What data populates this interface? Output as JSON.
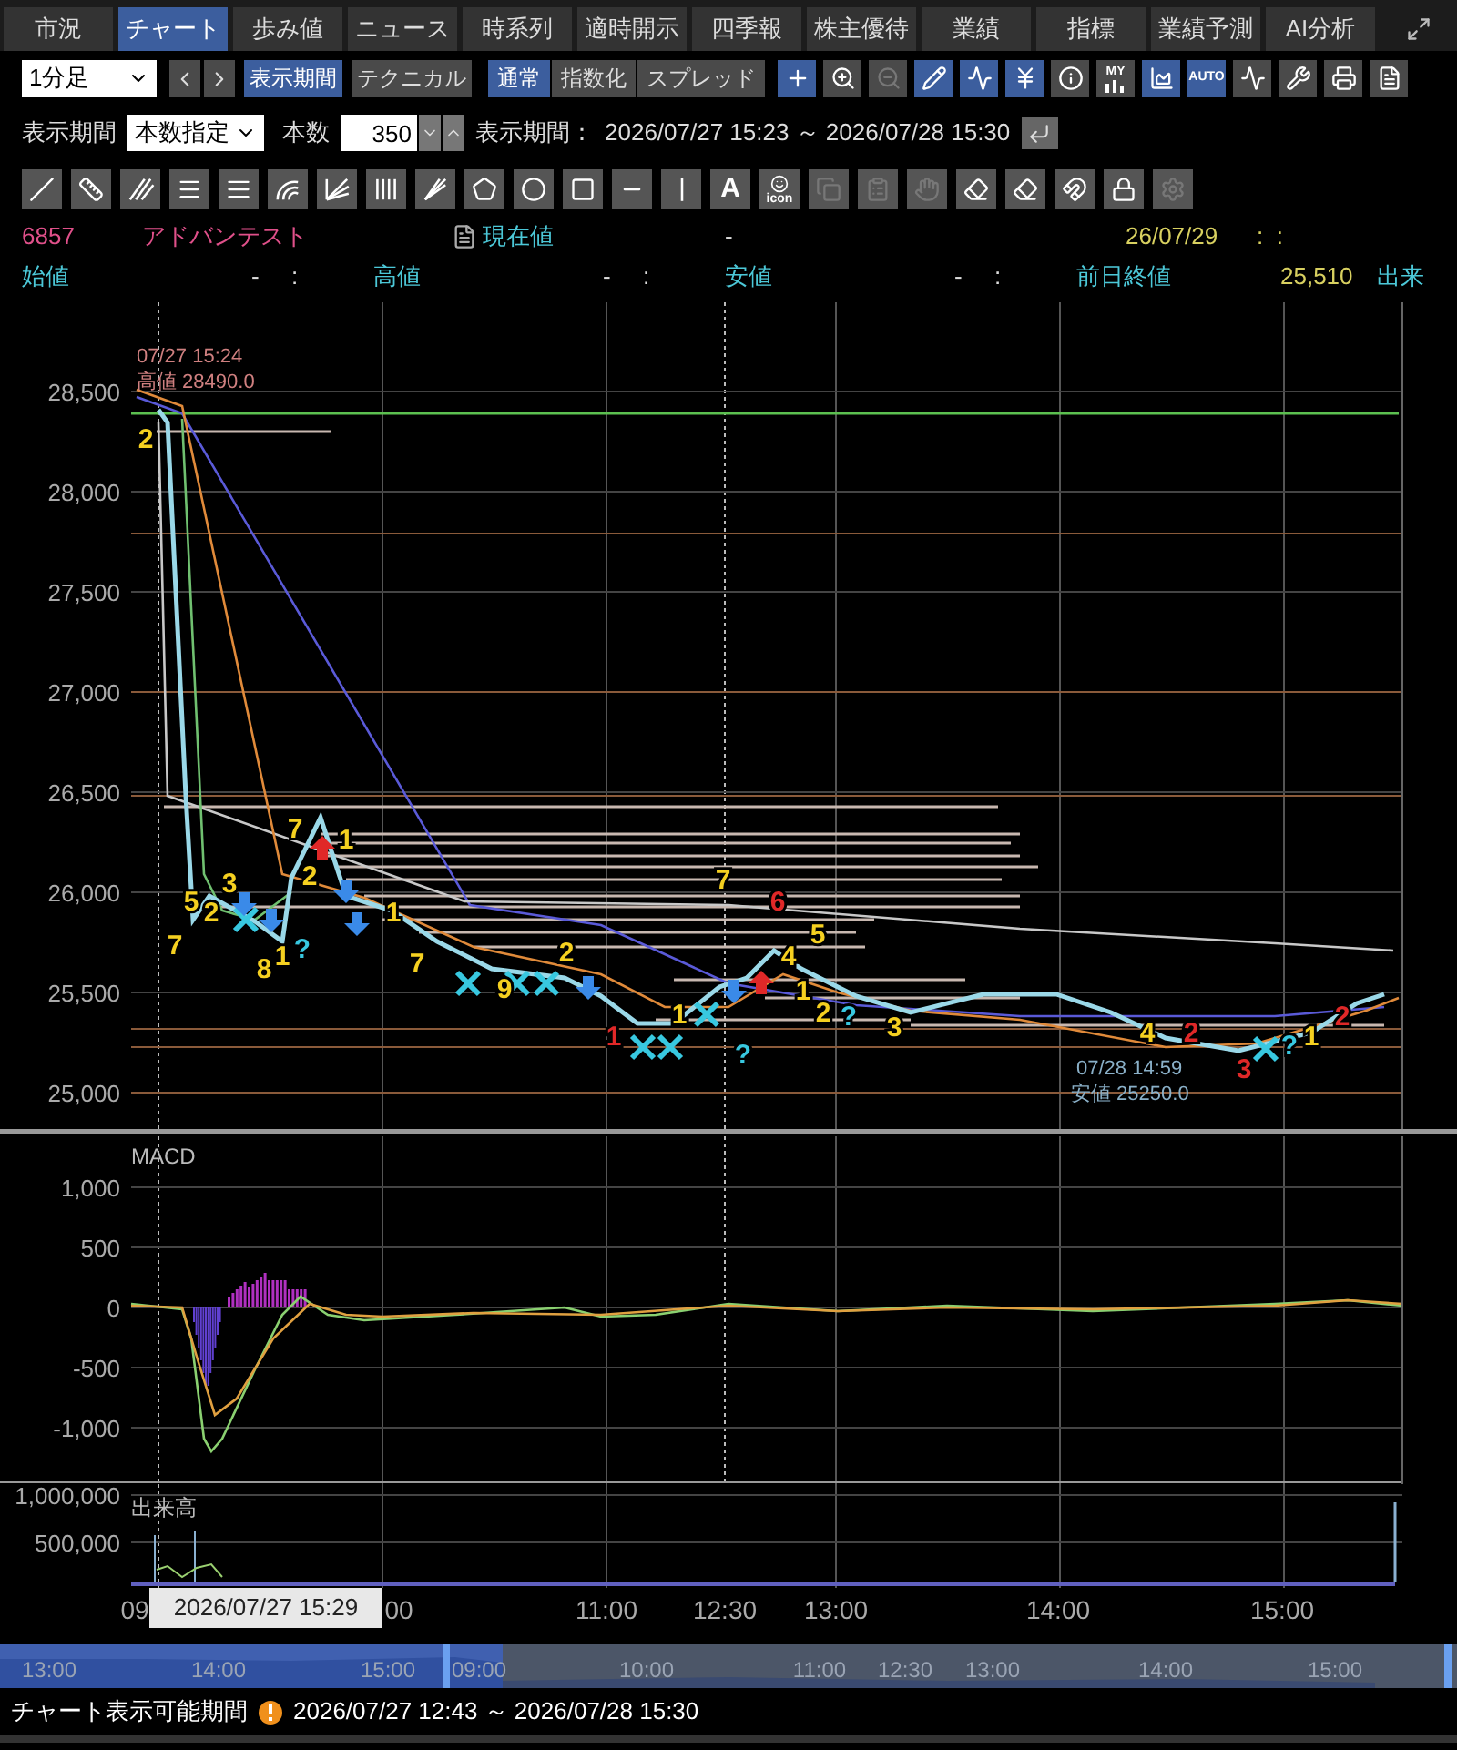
{
  "tabs": [
    {
      "label": "市況",
      "selected": false
    },
    {
      "label": "チャート",
      "selected": true
    },
    {
      "label": "歩み値",
      "selected": false
    },
    {
      "label": "ニュース",
      "selected": false
    },
    {
      "label": "時系列",
      "selected": false
    },
    {
      "label": "適時開示",
      "selected": false
    },
    {
      "label": "四季報",
      "selected": false
    },
    {
      "label": "株主優待",
      "selected": false
    },
    {
      "label": "業績",
      "selected": false
    },
    {
      "label": "指標",
      "selected": false
    },
    {
      "label": "業績予測",
      "selected": false
    },
    {
      "label": "AI分析",
      "selected": false
    }
  ],
  "toolbar": {
    "interval": "1分足",
    "buttons": [
      {
        "label": "表示期間",
        "selected": true
      },
      {
        "label": "テクニカル",
        "selected": false
      }
    ],
    "modes": [
      {
        "label": "通常",
        "selected": true
      },
      {
        "label": "指数化",
        "selected": false
      },
      {
        "label": "スプレッド",
        "selected": false
      }
    ],
    "tools": [
      {
        "kind": "plus",
        "selected": true,
        "disabled": false
      },
      {
        "kind": "zoom-in",
        "selected": false,
        "disabled": false
      },
      {
        "kind": "zoom-out",
        "selected": false,
        "disabled": true
      },
      {
        "kind": "pencil",
        "selected": true,
        "disabled": false
      },
      {
        "kind": "cursor",
        "selected": true,
        "disabled": false
      },
      {
        "kind": "yen",
        "selected": true,
        "disabled": false
      },
      {
        "kind": "info",
        "selected": false,
        "disabled": false
      },
      {
        "kind": "my",
        "label": "MY",
        "selected": false,
        "disabled": false
      },
      {
        "kind": "area",
        "selected": true,
        "disabled": false
      },
      {
        "kind": "auto",
        "label": "AUTO",
        "selected": true,
        "disabled": false
      },
      {
        "kind": "wave",
        "selected": false,
        "disabled": false
      },
      {
        "kind": "wrench",
        "selected": false,
        "disabled": false
      },
      {
        "kind": "print",
        "selected": false,
        "disabled": false
      },
      {
        "kind": "page",
        "selected": false,
        "disabled": false
      }
    ]
  },
  "period": {
    "label": "表示期間",
    "mode": "本数指定",
    "count_label": "本数",
    "count": "350",
    "range_label": "表示期間：",
    "range": "2026/07/27 15:23 ～ 2026/07/28 15:30"
  },
  "drawing_tools": [
    {
      "kind": "line",
      "disabled": false
    },
    {
      "kind": "ruler",
      "disabled": false
    },
    {
      "kind": "parallel",
      "disabled": false
    },
    {
      "kind": "lines",
      "disabled": false
    },
    {
      "kind": "many-lines",
      "disabled": false
    },
    {
      "kind": "arc",
      "disabled": false
    },
    {
      "kind": "fan",
      "disabled": false
    },
    {
      "kind": "vertical-lines",
      "disabled": false
    },
    {
      "kind": "fan2",
      "disabled": false
    },
    {
      "kind": "pentagon",
      "disabled": false
    },
    {
      "kind": "circle",
      "disabled": false
    },
    {
      "kind": "square",
      "disabled": false
    },
    {
      "kind": "h-line",
      "disabled": false
    },
    {
      "kind": "v-line",
      "disabled": false
    },
    {
      "kind": "text",
      "label": "A",
      "disabled": false
    },
    {
      "kind": "smiley",
      "label": "icon",
      "disabled": false
    },
    {
      "kind": "copy",
      "disabled": true
    },
    {
      "kind": "clipboard",
      "disabled": true
    },
    {
      "kind": "hand",
      "disabled": true
    },
    {
      "kind": "eraser",
      "disabled": false
    },
    {
      "kind": "eraser-a",
      "disabled": false
    },
    {
      "kind": "magnet",
      "disabled": false
    },
    {
      "kind": "lock",
      "disabled": false
    },
    {
      "kind": "gear",
      "disabled": true
    }
  ],
  "quote": {
    "code": "6857",
    "name": "アドバンテスト",
    "current_label": "現在値",
    "current": "-",
    "date": "26/07/29",
    "time": ":  :",
    "fields": [
      {
        "label": "始値",
        "value": "-",
        "time": ":"
      },
      {
        "label": "高値",
        "value": "-",
        "time": ":"
      },
      {
        "label": "安値",
        "value": "-",
        "time": ":"
      },
      {
        "label": "前日終値",
        "value": "25,510"
      }
    ],
    "volume_label": "出来"
  },
  "price_chart": {
    "yticks": [
      "28,500",
      "28,000",
      "27,500",
      "27,000",
      "26,500",
      "26,000",
      "25,500",
      "25,000"
    ],
    "high": {
      "time": "07/27 15:24",
      "label": "高値 28490.0"
    },
    "low": {
      "time": "07/28 14:59",
      "label": "安値 25250.0"
    },
    "markers": [
      {
        "text": "2",
        "color": "#f5d020"
      },
      {
        "text": "7",
        "color": "#f5d020"
      },
      {
        "text": "5",
        "color": "#f5d020"
      },
      {
        "text": "2",
        "color": "#f5d020"
      },
      {
        "text": "3",
        "color": "#f5d020"
      },
      {
        "text": "8",
        "color": "#f5d020"
      },
      {
        "text": "1",
        "color": "#f5d020"
      },
      {
        "text": "?",
        "color": "#38c8e0"
      },
      {
        "text": "7",
        "color": "#f5d020"
      },
      {
        "text": "2",
        "color": "#f5d020"
      },
      {
        "text": "1",
        "color": "#f5d020"
      },
      {
        "text": "1",
        "color": "#f5d020"
      },
      {
        "text": "7",
        "color": "#f5d020"
      },
      {
        "text": "9",
        "color": "#f5d020"
      },
      {
        "text": "2",
        "color": "#f5d020"
      },
      {
        "text": "1",
        "color": "#e02828"
      },
      {
        "text": "1",
        "color": "#f5d020"
      },
      {
        "text": "7",
        "color": "#f5d020"
      },
      {
        "text": "6",
        "color": "#e02828"
      },
      {
        "text": "4",
        "color": "#f5d020"
      },
      {
        "text": "5",
        "color": "#f5d020"
      },
      {
        "text": "1",
        "color": "#f5d020"
      },
      {
        "text": "2",
        "color": "#f5d020"
      },
      {
        "text": "?",
        "color": "#38c8e0"
      },
      {
        "text": "3",
        "color": "#f5d020"
      },
      {
        "text": "?",
        "color": "#38c8e0"
      },
      {
        "text": "4",
        "color": "#f5d020"
      },
      {
        "text": "2",
        "color": "#e02828"
      },
      {
        "text": "3",
        "color": "#e02828"
      },
      {
        "text": "?",
        "color": "#38c8e0"
      },
      {
        "text": "1",
        "color": "#f5d020"
      },
      {
        "text": "2",
        "color": "#e02828"
      }
    ]
  },
  "macd": {
    "title": "MACD",
    "yticks": [
      "1,000",
      "500",
      "0",
      "-500",
      "-1,000"
    ]
  },
  "volume": {
    "title": "出来高",
    "yticks": [
      "1,000,000",
      "500,000"
    ]
  },
  "time_axis": {
    "labels": [
      "09",
      "00",
      "11:00",
      "12:30",
      "13:00",
      "14:00",
      "15:00"
    ],
    "cursor": "2026/07/27 15:29"
  },
  "navigator": {
    "labels": [
      "13:00",
      "14:00",
      "15:00",
      "09:00",
      "10:00",
      "11:00",
      "12:30",
      "13:00",
      "14:00",
      "15:00"
    ]
  },
  "status": {
    "label": "チャート表示可能期間",
    "range": "2026/07/27 12:43 ～ 2026/07/28 15:30"
  }
}
